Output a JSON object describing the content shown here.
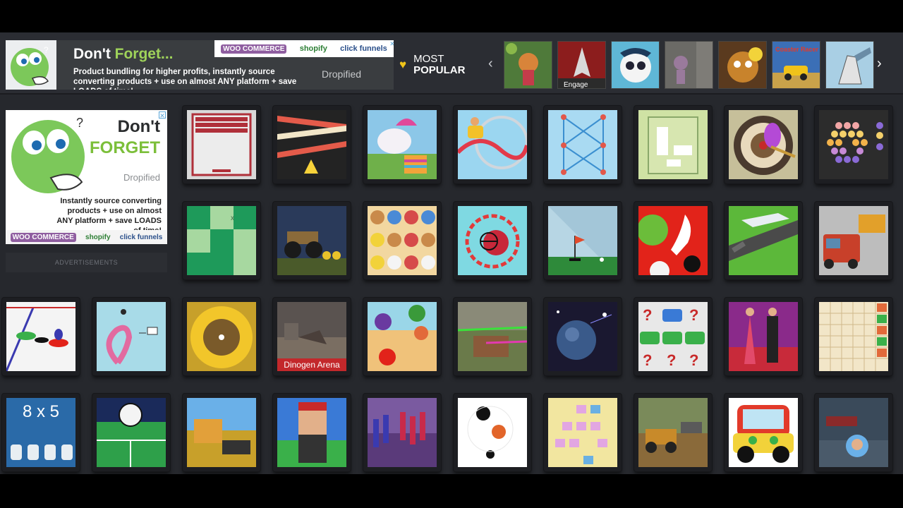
{
  "top_ad": {
    "headline_dont": "Don't",
    "headline_forget": "Forget...",
    "body": "Product bundling for higher profits, instantly source converting products + use on almost ANY platform + save LOADS of time!",
    "brand": "Dropified",
    "logo_woo": "WOO COMMERCE",
    "logo_shopify": "shopify",
    "logo_cf": "click funnels",
    "close": "✕"
  },
  "most_popular": {
    "line1": "MOST",
    "line2": "POPULAR",
    "heart_icon": "heart-icon",
    "heart_color": "#f0c419",
    "prev": "‹",
    "next": "›"
  },
  "popular_games": [
    {
      "name": "jungle-princess"
    },
    {
      "name": "space-shooter"
    },
    {
      "name": "panda-adventure"
    },
    {
      "name": "stickman-escape"
    },
    {
      "name": "cat-face"
    },
    {
      "name": "coaster-racer-2",
      "label": "Coaster Racer 2"
    },
    {
      "name": "robot-battle"
    }
  ],
  "side_ad": {
    "headline_dont": "Don't",
    "headline_forget": "FORGET",
    "brand": "Dropified",
    "body": "Instantly source converting products + use on almost ANY platform + save LOADS of time!",
    "logo_woo": "WOO COMMERCE",
    "logo_shopify": "shopify",
    "logo_cf": "click funnels",
    "close": "✕",
    "ads_label": "ADVERTISEMENTS"
  },
  "games": {
    "dinogen_label": "Dinogen Arena",
    "math_label": "8 x 5"
  }
}
